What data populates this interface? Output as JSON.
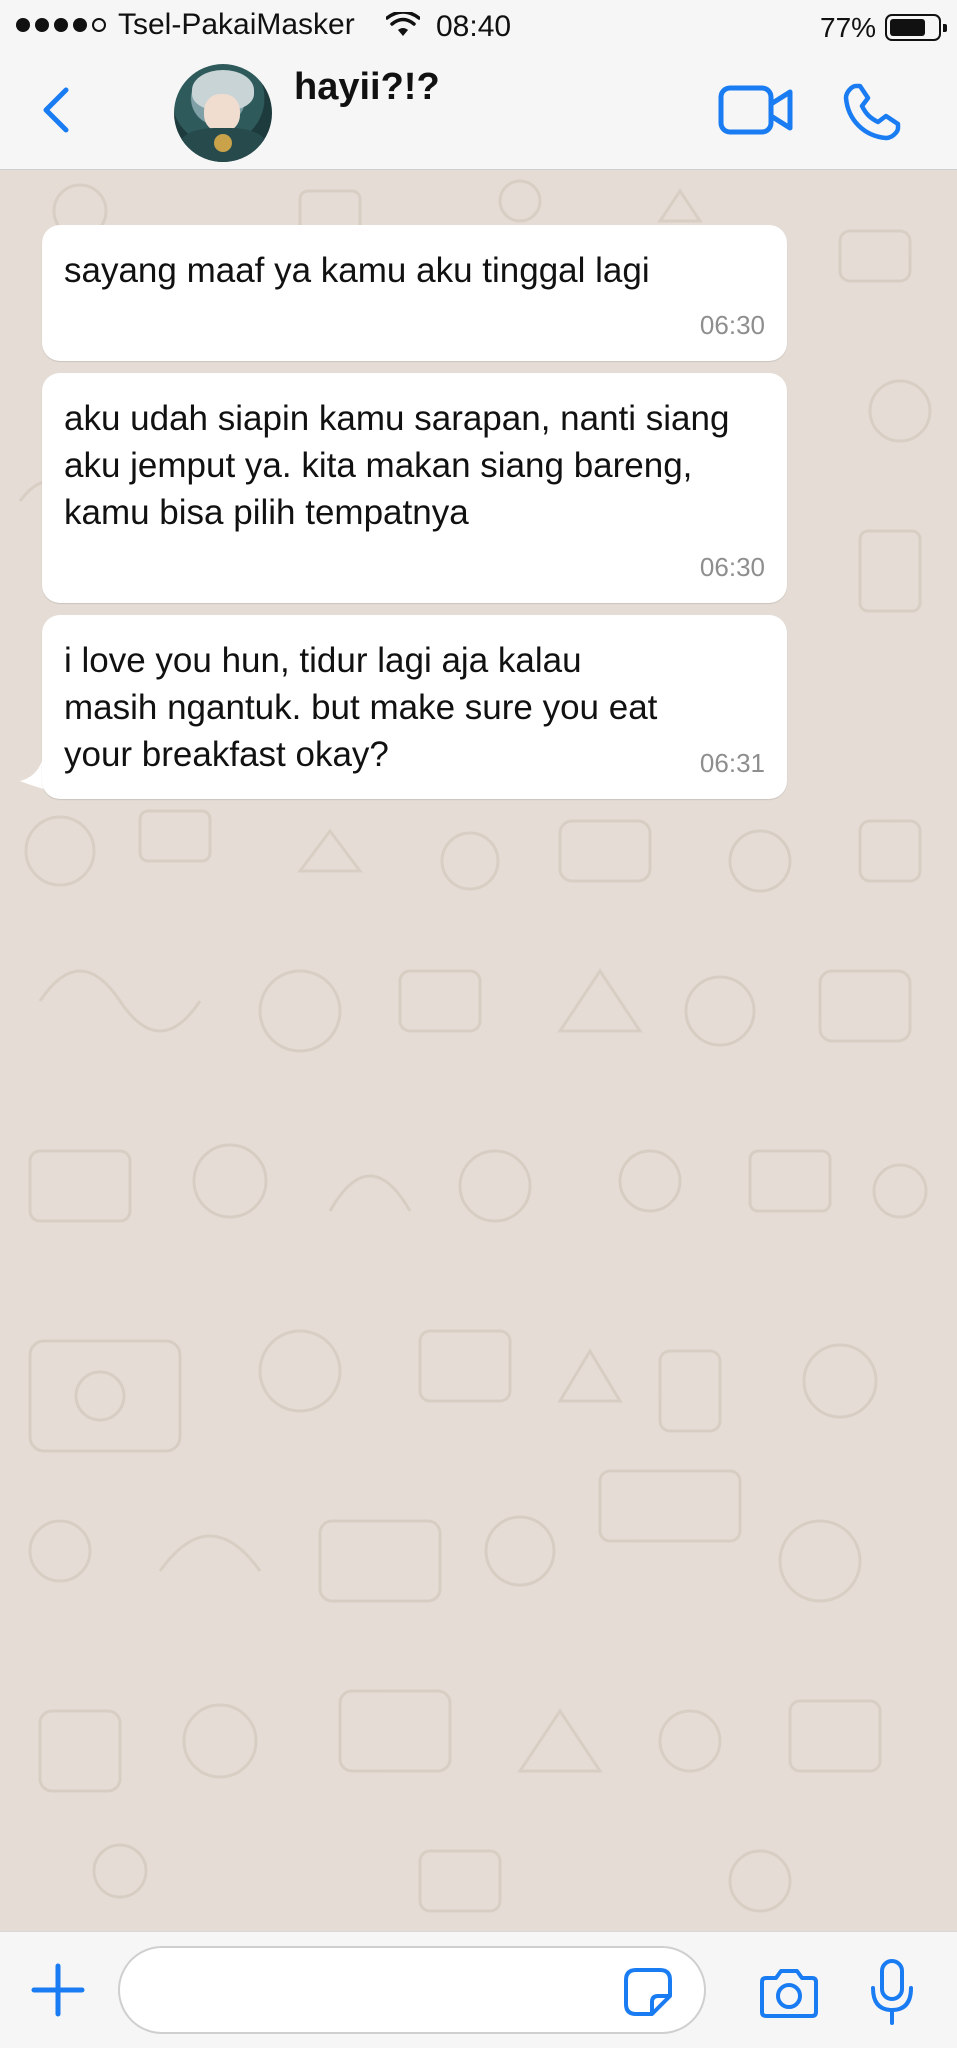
{
  "status_bar": {
    "carrier": "Tsel-PakaiMasker",
    "time": "08:40",
    "battery_percent": "77%",
    "battery_level": 0.77,
    "signal_bars": 4,
    "signal_total": 5
  },
  "header": {
    "contact_name": "hayii?!?"
  },
  "messages": [
    {
      "text": "sayang maaf ya kamu aku tinggal lagi",
      "time": "06:30"
    },
    {
      "text": "aku udah siapin kamu sarapan, nanti siang aku jemput ya. kita makan siang bareng, kamu bisa pilih tempatnya",
      "time": "06:30"
    },
    {
      "text": "i love you hun, tidur lagi aja kalau masih ngantuk. but make sure you eat your breakfast okay?",
      "time": "06:31"
    }
  ],
  "input": {
    "value": "",
    "placeholder": ""
  },
  "icons": {
    "back": "chevron-left-icon",
    "video": "video-camera-icon",
    "call": "phone-icon",
    "add": "plus-icon",
    "sticker": "sticker-icon",
    "camera": "camera-icon",
    "mic": "microphone-icon"
  },
  "colors": {
    "accent": "#1a7cf2",
    "chat_background": "#e5ddd5",
    "bubble": "#ffffff",
    "timestamp": "#8e8e8e"
  }
}
